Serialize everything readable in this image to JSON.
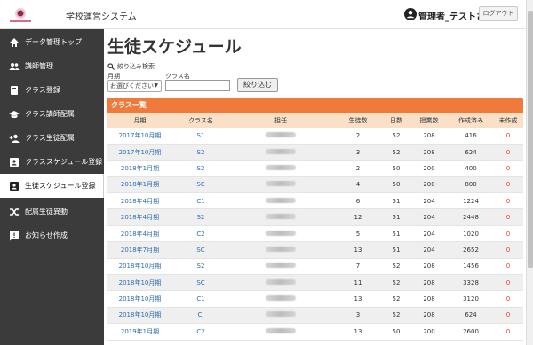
{
  "header": {
    "app_title": "学校運営システム",
    "user_name": "管理者_テストさん",
    "logout_label": "ログアウト"
  },
  "sidebar": {
    "items": [
      {
        "label": "データ管理トップ",
        "icon": "home-icon"
      },
      {
        "label": "講師管理",
        "icon": "people-icon"
      },
      {
        "label": "クラス登録",
        "icon": "book-icon"
      },
      {
        "label": "クラス講師配属",
        "icon": "graduation-cap-icon"
      },
      {
        "label": "クラス生徒配属",
        "icon": "person-add-icon"
      },
      {
        "label": "クラススケジュール登録",
        "icon": "id-card-icon"
      },
      {
        "label": "生徒スケジュール登録",
        "icon": "id-card-icon",
        "active": true
      },
      {
        "label": "配属生徒異動",
        "icon": "shuffle-icon"
      },
      {
        "label": "お知らせ作成",
        "icon": "announcement-icon"
      }
    ]
  },
  "main": {
    "title": "生徒スケジュール",
    "filter": {
      "heading": "絞り込み検索",
      "month_label": "月期",
      "month_selected": "お選びください",
      "class_label": "クラス名",
      "class_value": "",
      "button_label": "絞り込む"
    },
    "panel_title": "クラス一覧",
    "table": {
      "columns": [
        "月期",
        "クラス名",
        "担任",
        "生徒数",
        "日数",
        "授業数",
        "作成済み",
        "未作成"
      ],
      "rows": [
        [
          "2017年10月期",
          "S1",
          "",
          "2",
          "52",
          "208",
          "416",
          "0"
        ],
        [
          "2017年10月期",
          "S2",
          "",
          "3",
          "52",
          "208",
          "624",
          "0"
        ],
        [
          "2018年1月期",
          "S2",
          "",
          "2",
          "50",
          "200",
          "400",
          "0"
        ],
        [
          "2018年1月期",
          "SC",
          "",
          "4",
          "50",
          "200",
          "800",
          "0"
        ],
        [
          "2018年4月期",
          "C1",
          "",
          "6",
          "51",
          "204",
          "1224",
          "0"
        ],
        [
          "2018年4月期",
          "S2",
          "",
          "12",
          "51",
          "204",
          "2448",
          "0"
        ],
        [
          "2018年4月期",
          "C2",
          "",
          "5",
          "51",
          "204",
          "1020",
          "0"
        ],
        [
          "2018年7月期",
          "SC",
          "",
          "13",
          "51",
          "204",
          "2652",
          "0"
        ],
        [
          "2018年10月期",
          "S2",
          "",
          "7",
          "52",
          "208",
          "1456",
          "0"
        ],
        [
          "2018年10月期",
          "SC",
          "",
          "11",
          "52",
          "208",
          "3328",
          "0"
        ],
        [
          "2018年10月期",
          "C1",
          "",
          "13",
          "52",
          "208",
          "3120",
          "0"
        ],
        [
          "2018年10月期",
          "CJ",
          "",
          "3",
          "52",
          "208",
          "624",
          "0"
        ],
        [
          "2019年1月期",
          "C2",
          "",
          "13",
          "50",
          "200",
          "2600",
          "0"
        ]
      ]
    }
  },
  "colors": {
    "sidebar_bg": "#3b3b3b",
    "panel_header": "#f07a3c",
    "table_header": "#fbe0c8",
    "link": "#2e6db4",
    "unfinished": "#e53935"
  }
}
